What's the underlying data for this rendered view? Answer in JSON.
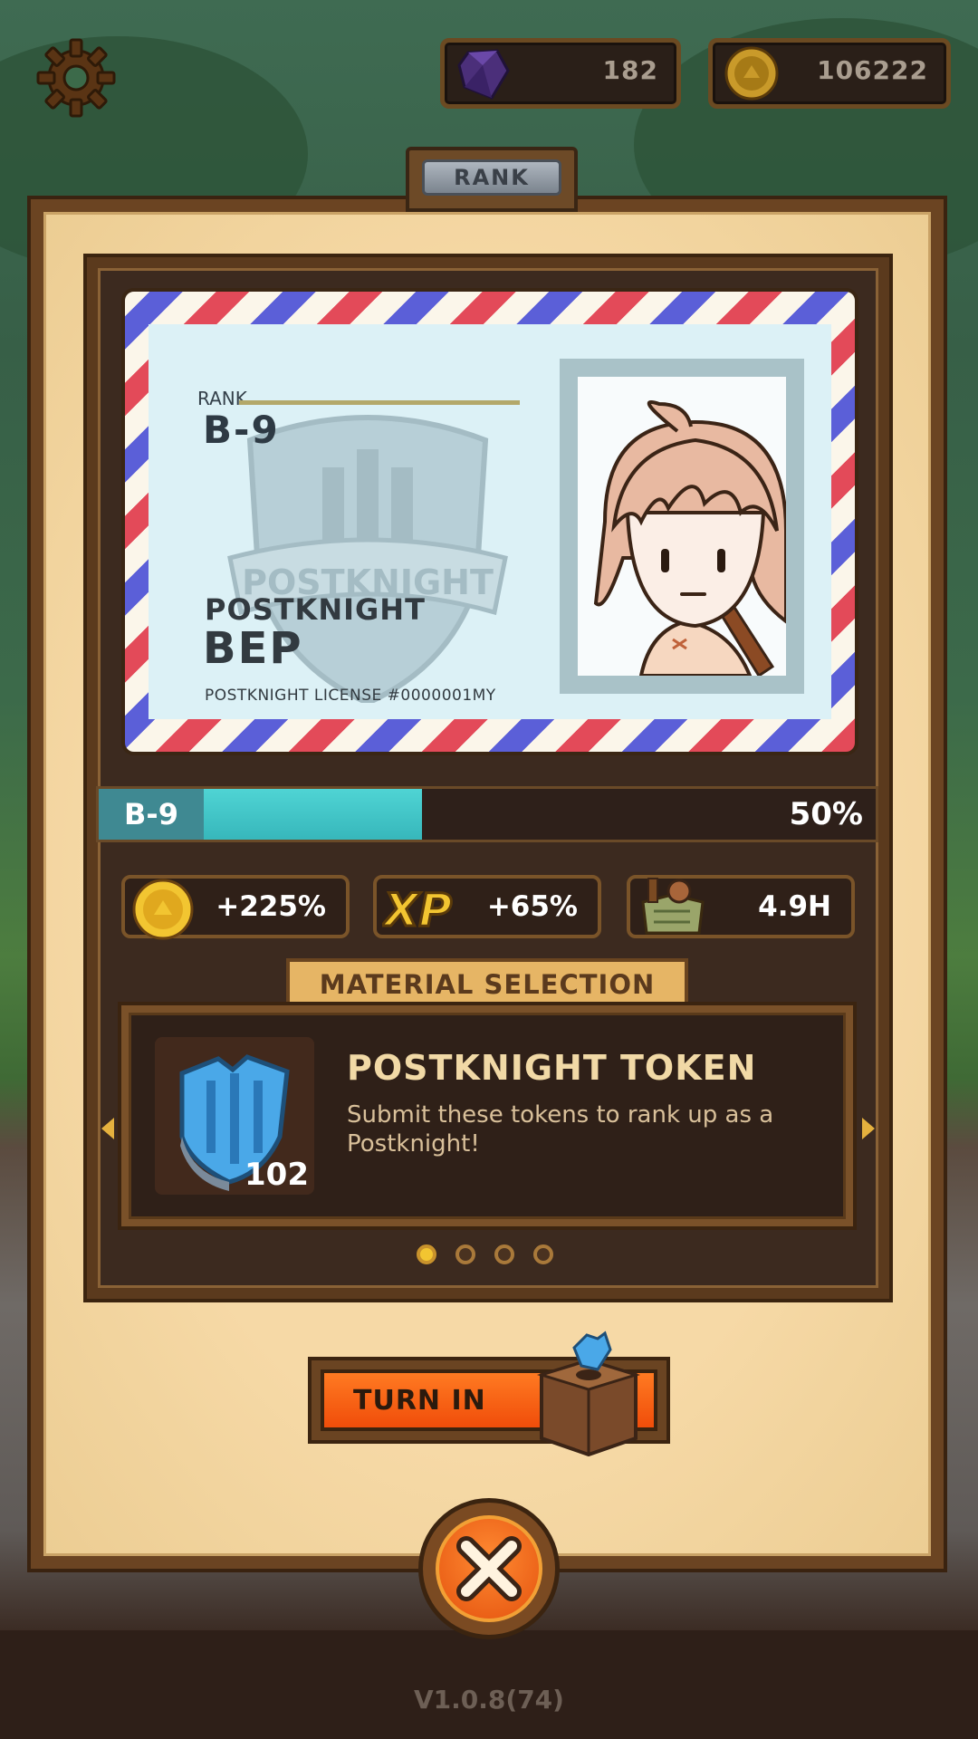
{
  "top_bar": {
    "settings_icon": "gear-icon",
    "gems": {
      "icon": "purple-gem-icon",
      "value": "182"
    },
    "coins": {
      "icon": "gold-coin-icon",
      "value": "106222"
    }
  },
  "panel": {
    "tab_label": "RANK"
  },
  "rank_card": {
    "rank_caption": "RANK",
    "rank_value": "B-9",
    "title": "POSTKNIGHT",
    "name": "BEP",
    "license": "POSTKNIGHT LICENSE #0000001MY",
    "crest_text": "POSTKNIGHT"
  },
  "progress": {
    "rank": "B-9",
    "percent_label": "50%",
    "fraction": 0.5
  },
  "bonuses": [
    {
      "icon": "gold-coin-icon",
      "value": "+225%"
    },
    {
      "icon": "xp-icon",
      "value": "+65%",
      "icon_text": "XP"
    },
    {
      "icon": "supply-crate-icon",
      "value": "4.9H"
    }
  ],
  "material": {
    "header": "MATERIAL SELECTION",
    "item_title": "POSTKNIGHT TOKEN",
    "item_description": "Submit these tokens to rank up as a Postknight!",
    "quantity": "102",
    "page_count": 4,
    "current_page": 1
  },
  "actions": {
    "turn_in_label": "TURN IN"
  },
  "footer": {
    "version": "V1.0.8(74)"
  },
  "colors": {
    "accent_orange": "#f04d0a",
    "progress_teal": "#4fd4d4",
    "panel_brown": "#6b4422",
    "paper": "#f6d9a6"
  }
}
